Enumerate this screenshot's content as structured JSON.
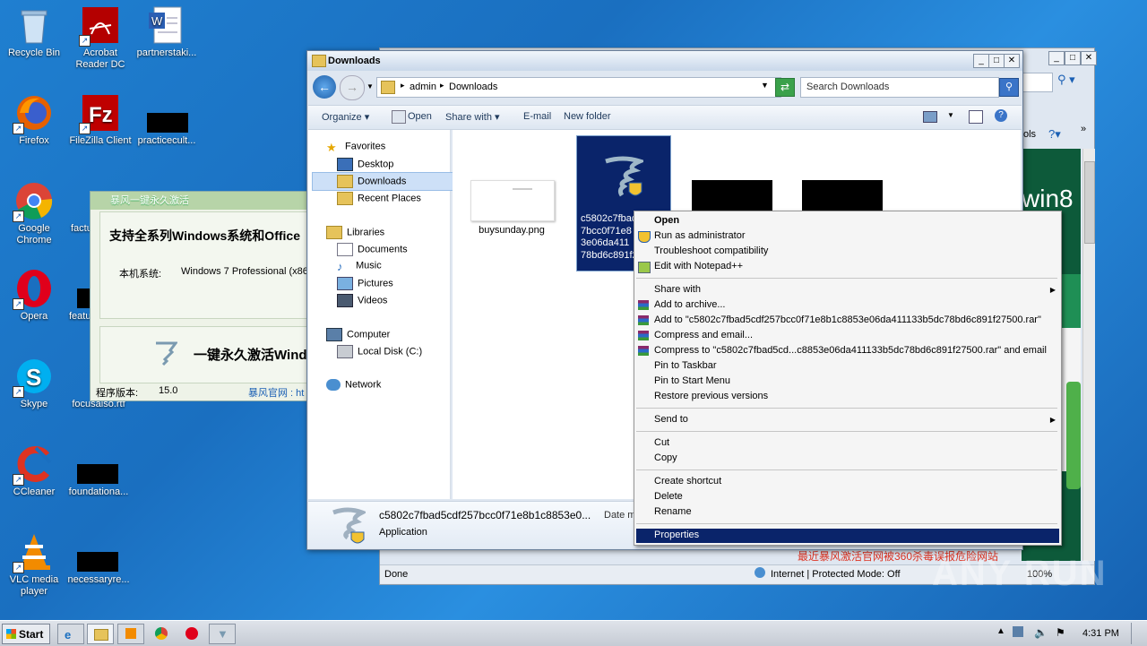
{
  "desktop": {
    "icons": [
      {
        "label": "Recycle Bin",
        "icon": "recycle-bin-icon"
      },
      {
        "label": "Acrobat Reader DC",
        "icon": "acrobat-icon"
      },
      {
        "label": "partnerstaki...",
        "icon": "word-doc-icon"
      },
      {
        "label": "Firefox",
        "icon": "firefox-icon"
      },
      {
        "label": "FileZilla Client",
        "icon": "filezilla-icon"
      },
      {
        "label": "practicecult...",
        "icon": "redacted-file-icon"
      },
      {
        "label": "Google Chrome",
        "icon": "chrome-icon"
      },
      {
        "label": "factu",
        "icon": "file-icon"
      },
      {
        "label": "Opera",
        "icon": "opera-icon"
      },
      {
        "label": "featu",
        "icon": "redacted-file-icon"
      },
      {
        "label": "Skype",
        "icon": "skype-icon"
      },
      {
        "label": "focusalso.rtf",
        "icon": "rtf-icon"
      },
      {
        "label": "CCleaner",
        "icon": "ccleaner-icon"
      },
      {
        "label": "foundationa...",
        "icon": "redacted-file-icon"
      },
      {
        "label": "VLC media player",
        "icon": "vlc-icon"
      },
      {
        "label": "necessaryre...",
        "icon": "redacted-file-icon"
      }
    ]
  },
  "bf_window": {
    "title": "暴风一键永久激活",
    "headline": "支持全系列Windows系统和Office",
    "system_label": "本机系统:",
    "system_value": "Windows 7 Professional (x86)",
    "activate_label": "一键永久激活Windo",
    "version_label": "程序版本:",
    "version_value": "15.0",
    "site_label": "暴风官网 : ht"
  },
  "ie_window": {
    "tools_label": "ols",
    "banner_text": "win8",
    "status_done": "Done",
    "status_zone": "Internet | Protected Mode: Off",
    "zoom": "100%",
    "red_link": "最近暴风激活官网被360杀毒误报危险网站"
  },
  "explorer": {
    "title": "Downloads",
    "breadcrumb": [
      "admin",
      "Downloads"
    ],
    "search_placeholder": "Search Downloads",
    "commands": {
      "organize": "Organize",
      "open": "Open",
      "share_with": "Share with",
      "email": "E-mail",
      "new_folder": "New folder"
    },
    "nav": {
      "favorites": "Favorites",
      "desktop": "Desktop",
      "downloads": "Downloads",
      "recent_places": "Recent Places",
      "libraries": "Libraries",
      "documents": "Documents",
      "music": "Music",
      "pictures": "Pictures",
      "videos": "Videos",
      "computer": "Computer",
      "local_disk": "Local Disk (C:)",
      "network": "Network"
    },
    "files": [
      {
        "name": "buysunday.png"
      },
      {
        "name": "c5802c7fbad5cdf257bcc0f71e8b1c8853e06da411133b5dc78bd6c891f27500",
        "name_lines": [
          "c5802c7fbad",
          "7bcc0f71e8",
          "3e06da411",
          "78bd6c891f2"
        ]
      }
    ],
    "details": {
      "filename": "c5802c7fbad5cdf257bcc0f71e8b1c8853e0...",
      "date_label": "Date m",
      "type": "Application"
    }
  },
  "context_menu": {
    "items": [
      {
        "label": "Open",
        "bold": true
      },
      {
        "label": "Run as administrator",
        "icon": "uac-shield-icon"
      },
      {
        "label": "Troubleshoot compatibility"
      },
      {
        "label": "Edit with Notepad++",
        "icon": "notepadpp-icon"
      },
      {
        "label": "Share with",
        "submenu": true
      },
      {
        "label": "Add to archive...",
        "icon": "winrar-icon"
      },
      {
        "label": "Add to \"c5802c7fbad5cdf257bcc0f71e8b1c8853e06da411133b5dc78bd6c891f27500.rar\"",
        "icon": "winrar-icon"
      },
      {
        "label": "Compress and email...",
        "icon": "winrar-icon"
      },
      {
        "label": "Compress to \"c5802c7fbad5cd...c8853e06da411133b5dc78bd6c891f27500.rar\" and email",
        "icon": "winrar-icon"
      },
      {
        "label": "Pin to Taskbar"
      },
      {
        "label": "Pin to Start Menu"
      },
      {
        "label": "Restore previous versions"
      },
      {
        "label": "Send to",
        "submenu": true
      },
      {
        "label": "Cut"
      },
      {
        "label": "Copy"
      },
      {
        "label": "Create shortcut"
      },
      {
        "label": "Delete"
      },
      {
        "label": "Rename"
      },
      {
        "label": "Properties",
        "highlighted": true
      }
    ]
  },
  "taskbar": {
    "start_label": "Start",
    "clock": "4:31 PM"
  },
  "watermark": "ANY RUN",
  "colors": {
    "selection": "#0a246a",
    "desktop": "#1f7fd0",
    "menu_highlight": "#0a246a"
  }
}
